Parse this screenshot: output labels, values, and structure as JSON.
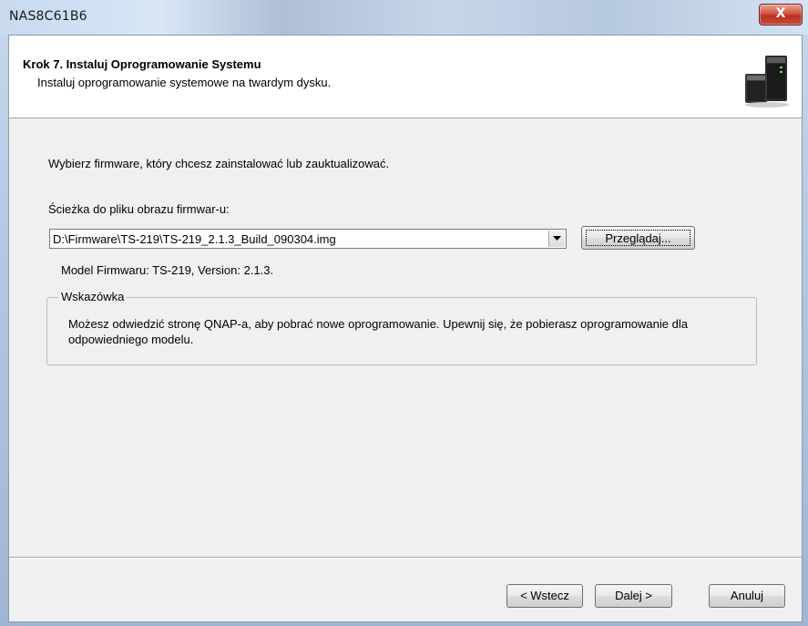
{
  "window": {
    "title": "NAS8C61B6",
    "close_label": "X"
  },
  "header": {
    "step_title": "Krok 7. Instaluj Oprogramowanie Systemu",
    "step_subtitle": "Instaluj oprogramowanie systemowe na twardym dysku."
  },
  "main": {
    "instruction": "Wybierz firmware, który chcesz zainstalować lub zauktualizować.",
    "path_label": "Ścieżka do pliku obrazu firmwar-u:",
    "path_value": "D:\\Firmware\\TS-219\\TS-219_2.1.3_Build_090304.img",
    "browse_label": "Przeglądaj...",
    "model_info": "Model Firmwaru: TS-219, Version: 2.1.3."
  },
  "hint": {
    "title": "Wskazówka",
    "text": "Możesz odwiedzić stronę QNAP-a, aby pobrać nowe oprogramowanie. Upewnij się, że pobierasz oprogramowanie dla odpowiedniego modelu."
  },
  "footer": {
    "back_label": "< Wstecz",
    "next_label": "Dalej >",
    "cancel_label": "Anuluj"
  },
  "icons": {
    "device": "nas-device-icon",
    "dropdown": "chevron-down-icon"
  },
  "colors": {
    "close_button": "#c94a37",
    "dialog_background": "#f0f0f0",
    "header_background": "#ffffff"
  }
}
